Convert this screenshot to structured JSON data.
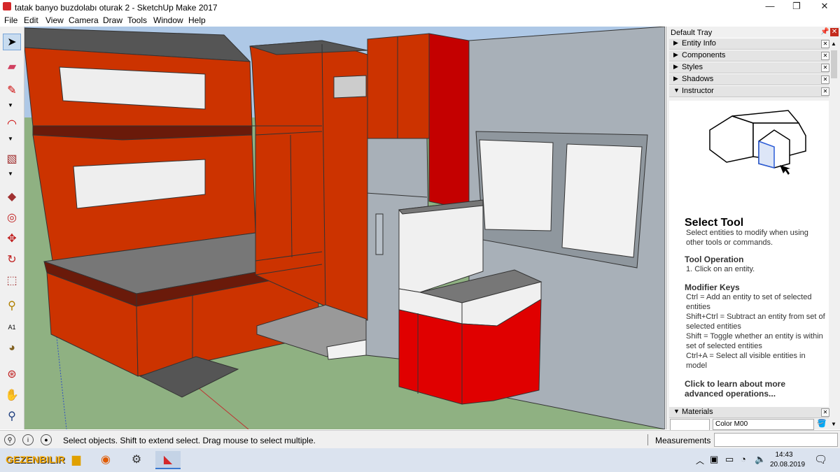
{
  "window": {
    "title": "tatak banyo buzdolabı oturak 2 - SketchUp Make 2017",
    "minimize": "—",
    "maximize": "❐",
    "close": "✕"
  },
  "menu": [
    "File",
    "Edit",
    "View",
    "Camera",
    "Draw",
    "Tools",
    "Window",
    "Help"
  ],
  "toolbar": {
    "tools": [
      {
        "name": "select-tool-icon",
        "glyph": "➤"
      },
      {
        "name": "eraser-tool-icon",
        "glyph": "▰"
      },
      {
        "name": "pencil-tool-icon",
        "glyph": "✎"
      },
      {
        "name": "arc-tool-icon",
        "glyph": "◠"
      },
      {
        "name": "rectangle-tool-icon",
        "glyph": "▧"
      },
      {
        "name": "push-pull-tool-icon",
        "glyph": "◆"
      },
      {
        "name": "offset-tool-icon",
        "glyph": "◎"
      },
      {
        "name": "move-tool-icon",
        "glyph": "✥"
      },
      {
        "name": "rotate-tool-icon",
        "glyph": "↻"
      },
      {
        "name": "scale-tool-icon",
        "glyph": "⬚"
      },
      {
        "name": "tape-measure-tool-icon",
        "glyph": "⚲"
      },
      {
        "name": "text-tool-icon",
        "glyph": "A1"
      },
      {
        "name": "paint-bucket-tool-icon",
        "glyph": "◕"
      },
      {
        "name": "orbit-tool-icon",
        "glyph": "⊛"
      },
      {
        "name": "pan-tool-icon",
        "glyph": "✋"
      },
      {
        "name": "zoom-tool-icon",
        "glyph": "⚲"
      }
    ]
  },
  "tray": {
    "title": "Default Tray",
    "panels": [
      {
        "label": "Entity Info",
        "expanded": false
      },
      {
        "label": "Components",
        "expanded": false
      },
      {
        "label": "Styles",
        "expanded": false
      },
      {
        "label": "Shadows",
        "expanded": false
      },
      {
        "label": "Instructor",
        "expanded": true
      }
    ],
    "instructor": {
      "title": "Select Tool",
      "desc": "Select entities to modify when using other tools or commands.",
      "op_title": "Tool Operation",
      "op_text": "1. Click on an entity.",
      "mod_title": "Modifier Keys",
      "mod_text": [
        "Ctrl = Add an entity to set of selected entities",
        "Shift+Ctrl = Subtract an entity from set of selected entities",
        "Shift = Toggle whether an entity is within set of selected entities",
        "Ctrl+A = Select all visible entities in model"
      ],
      "link": "Click to learn about more advanced operations..."
    },
    "materials": {
      "label": "Materials",
      "color_name": "Color M00"
    }
  },
  "status": {
    "text": "Select objects. Shift to extend select. Drag mouse to select multiple.",
    "measurements_label": "Measurements",
    "measurements_value": ""
  },
  "taskbar": {
    "logo": "GEZENBILIR",
    "time": "14:43",
    "date": "20.08.2019"
  }
}
